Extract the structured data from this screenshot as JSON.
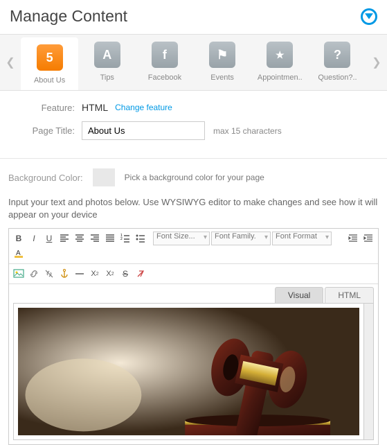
{
  "header": {
    "title": "Manage Content"
  },
  "tabs": [
    {
      "label": "About Us",
      "icon": "5"
    },
    {
      "label": "Tips",
      "icon": "A"
    },
    {
      "label": "Facebook",
      "icon": "f"
    },
    {
      "label": "Events",
      "icon": "⚑"
    },
    {
      "label": "Appointmen..",
      "icon": "★"
    },
    {
      "label": "Question?..",
      "icon": "?"
    }
  ],
  "form": {
    "feature_label": "Feature:",
    "feature_value": "HTML",
    "change_feature": "Change feature",
    "title_label": "Page Title:",
    "title_value": "About Us",
    "title_hint": "max 15 characters"
  },
  "bg": {
    "label": "Background Color:",
    "hint": "Pick a background color for your page"
  },
  "instructions": "Input your text and photos below. Use WYSIWYG editor to make changes and see how it will appear on your device",
  "selects": {
    "fontsize": "Font Size...",
    "fontfamily": "Font Family.",
    "fontformat": "Font Format"
  },
  "mode": {
    "visual": "Visual",
    "html": "HTML"
  }
}
